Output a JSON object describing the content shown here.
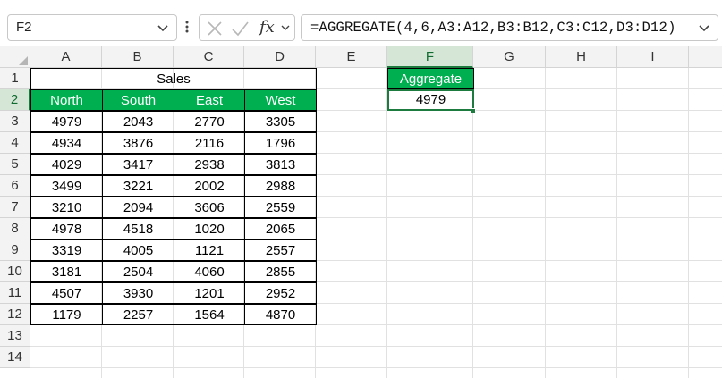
{
  "formula_bar": {
    "name_box": "F2",
    "fx_label": "fx",
    "formula": "=AGGREGATE(4,6,A3:A12,B3:B12,C3:C12,D3:D12)"
  },
  "grid": {
    "columns": [
      "A",
      "B",
      "C",
      "D",
      "E",
      "F",
      "G",
      "H",
      "I"
    ],
    "rows": [
      "1",
      "2",
      "3",
      "4",
      "5",
      "6",
      "7",
      "8",
      "9",
      "10",
      "11",
      "12",
      "13",
      "14"
    ],
    "selected_column": "F",
    "selected_row": "2"
  },
  "table": {
    "title": "Sales",
    "headers": [
      "North",
      "South",
      "East",
      "West"
    ],
    "rows": [
      [
        "4979",
        "2043",
        "2770",
        "3305"
      ],
      [
        "4934",
        "3876",
        "2116",
        "1796"
      ],
      [
        "4029",
        "3417",
        "2938",
        "3813"
      ],
      [
        "3499",
        "3221",
        "2002",
        "2988"
      ],
      [
        "3210",
        "2094",
        "3606",
        "2559"
      ],
      [
        "4978",
        "4518",
        "1020",
        "2065"
      ],
      [
        "3319",
        "4005",
        "1121",
        "2557"
      ],
      [
        "3181",
        "2504",
        "4060",
        "2855"
      ],
      [
        "4507",
        "3930",
        "1201",
        "2952"
      ],
      [
        "1179",
        "2257",
        "1564",
        "4870"
      ]
    ]
  },
  "aggregate": {
    "label": "Aggregate",
    "value": "4979"
  },
  "colors": {
    "header_green": "#00b050",
    "selection_green": "#1e7b3f"
  }
}
